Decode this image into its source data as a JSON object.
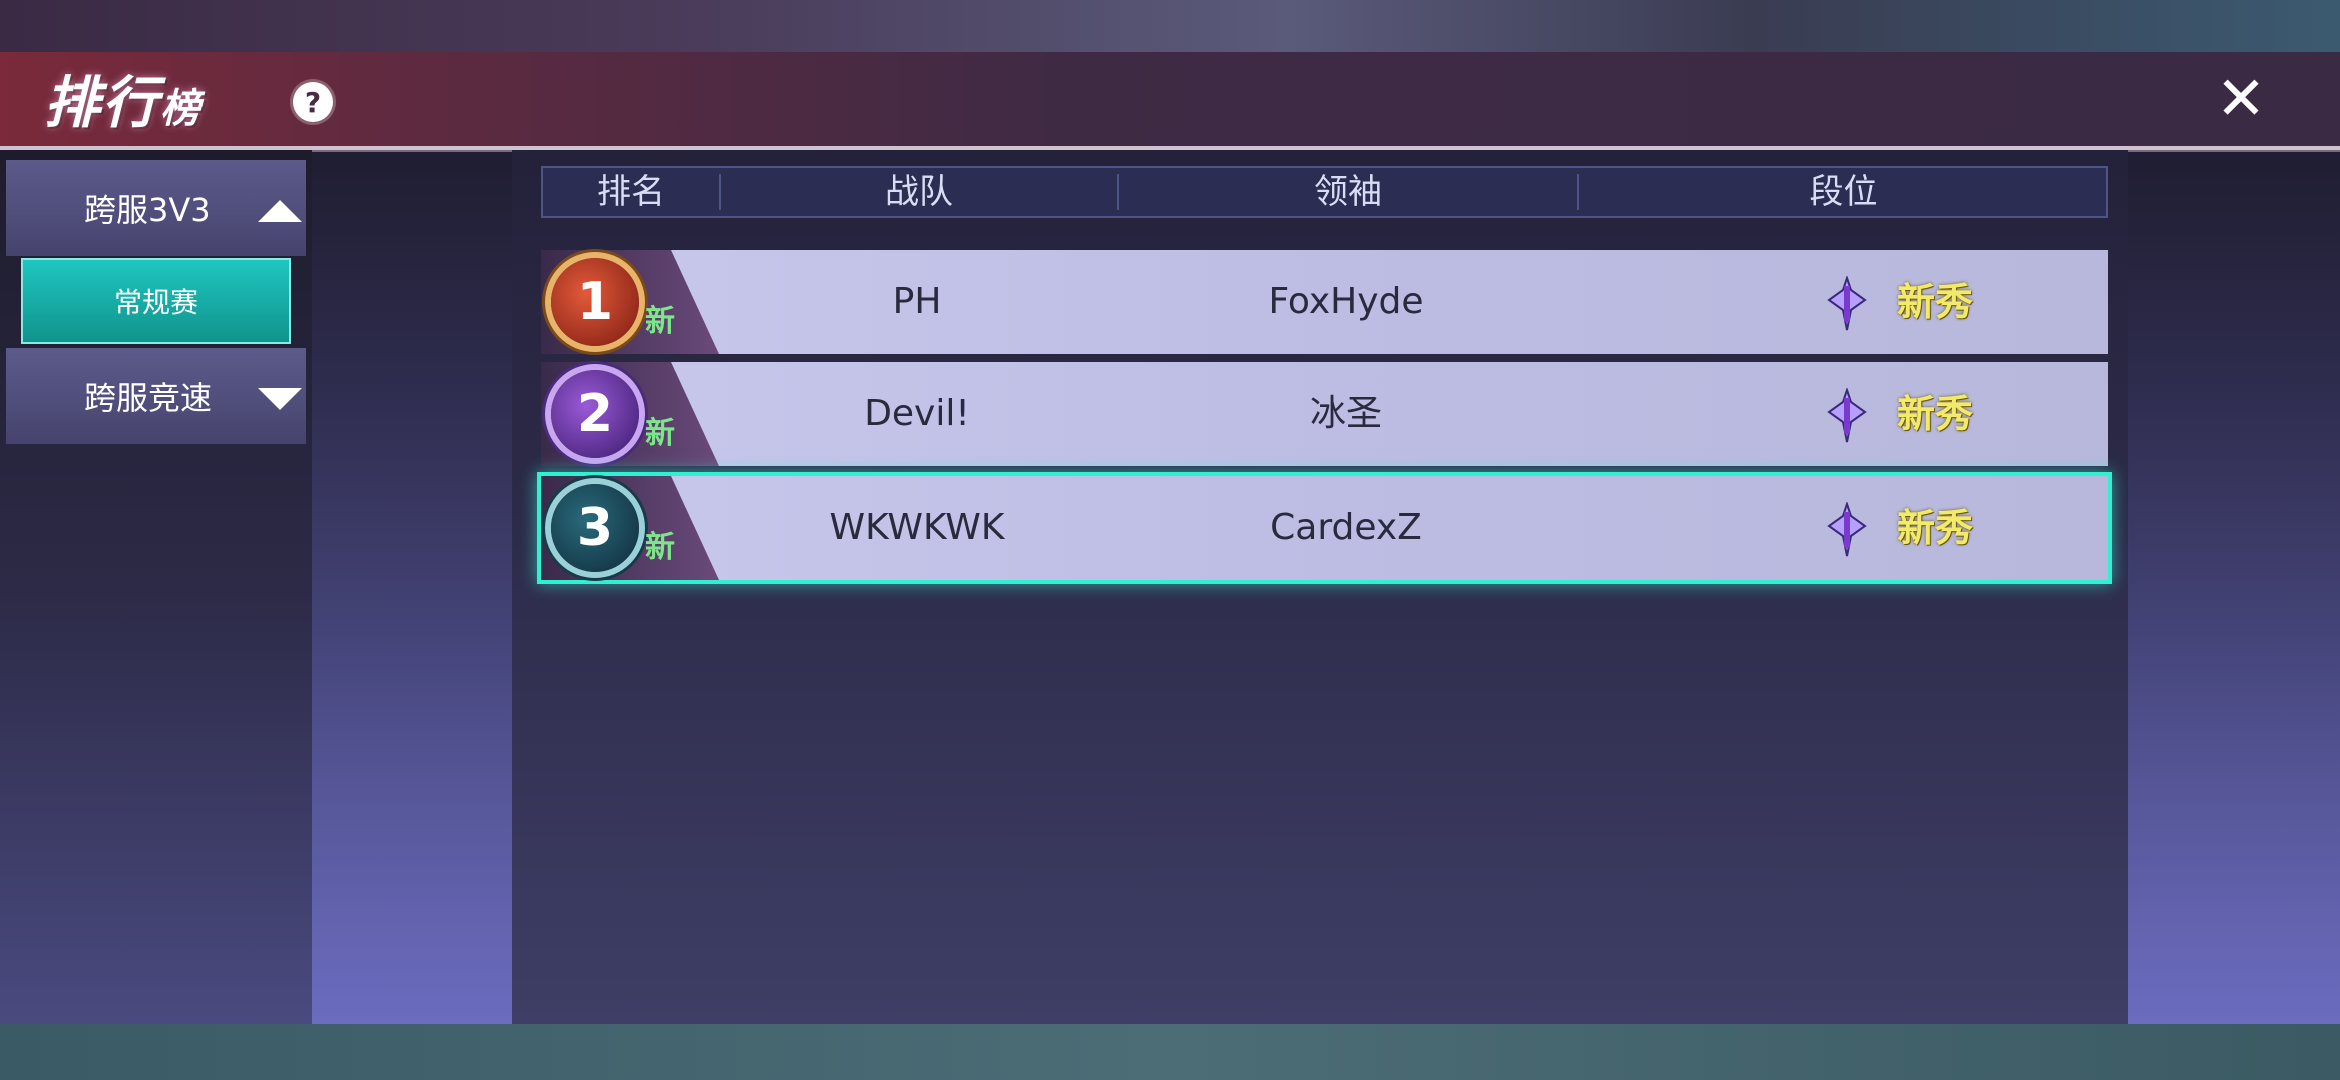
{
  "header": {
    "title_main": "排行",
    "title_small": "榜",
    "help_label": "?",
    "close_label": "✕"
  },
  "sidebar": {
    "categories": [
      {
        "label": "跨服3V3",
        "expanded": true,
        "sub_items": [
          {
            "label": "常规赛",
            "selected": true
          }
        ]
      },
      {
        "label": "跨服竞速",
        "expanded": false
      }
    ]
  },
  "table": {
    "headers": [
      "排名",
      "战队",
      "领袖",
      "段位"
    ],
    "rows": [
      {
        "rank": "1",
        "tag": "新",
        "team": "PH",
        "leader": "FoxHyde",
        "tier": "新秀"
      },
      {
        "rank": "2",
        "tag": "新",
        "team": "Devil!",
        "leader": "冰圣",
        "tier": "新秀"
      },
      {
        "rank": "3",
        "tag": "新",
        "team": "WKWKWK",
        "leader": "CardexZ",
        "tier": "新秀"
      }
    ],
    "selected_row": 3
  },
  "colors": {
    "accent_teal": "#1fc6c0",
    "tier_text": "#f4ea6a",
    "new_tag": "#7ee68a"
  }
}
